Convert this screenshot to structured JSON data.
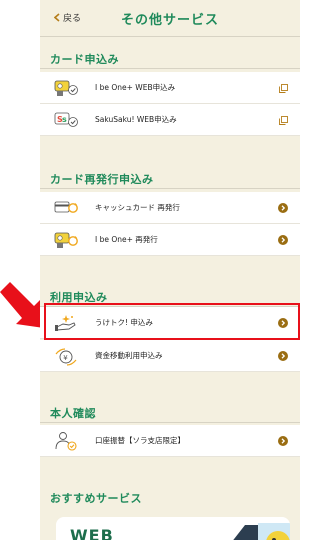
{
  "header": {
    "back_label": "戻る",
    "title": "その他サービス"
  },
  "sections": [
    {
      "title": "カード申込み",
      "items": [
        {
          "label": "I be One+ WEB申込み",
          "icon": "card-mascot-check-icon",
          "action": "external-link-icon"
        },
        {
          "label": "SakuSaku! WEB申込み",
          "icon": "saku-card-check-icon",
          "action": "external-link-icon"
        }
      ]
    },
    {
      "title": "カード再発行申込み",
      "items": [
        {
          "label": "キャッシュカード 再発行",
          "icon": "cash-card-reissue-icon",
          "action": "chevron-right-icon"
        },
        {
          "label": "I be One+ 再発行",
          "icon": "mascot-card-reissue-icon",
          "action": "chevron-right-icon"
        }
      ]
    },
    {
      "title": "利用申込み",
      "items": [
        {
          "label": "うけトク! 申込み",
          "icon": "hand-sparkle-icon",
          "action": "chevron-right-icon"
        },
        {
          "label": "資金移動利用申込み",
          "icon": "money-transfer-icon",
          "action": "chevron-right-icon"
        }
      ]
    },
    {
      "title": "本人確認",
      "items": [
        {
          "label": "口座振替【ソラ支店限定】",
          "icon": "person-check-icon",
          "action": "chevron-right-icon"
        }
      ]
    },
    {
      "title": "おすすめサービス",
      "items": []
    }
  ],
  "banner": {
    "text": "WEB"
  },
  "colors": {
    "brand_green": "#1f8a5b",
    "background": "#f4f0e0",
    "chevron": "#9a6d12",
    "highlight": "#e8101a"
  }
}
